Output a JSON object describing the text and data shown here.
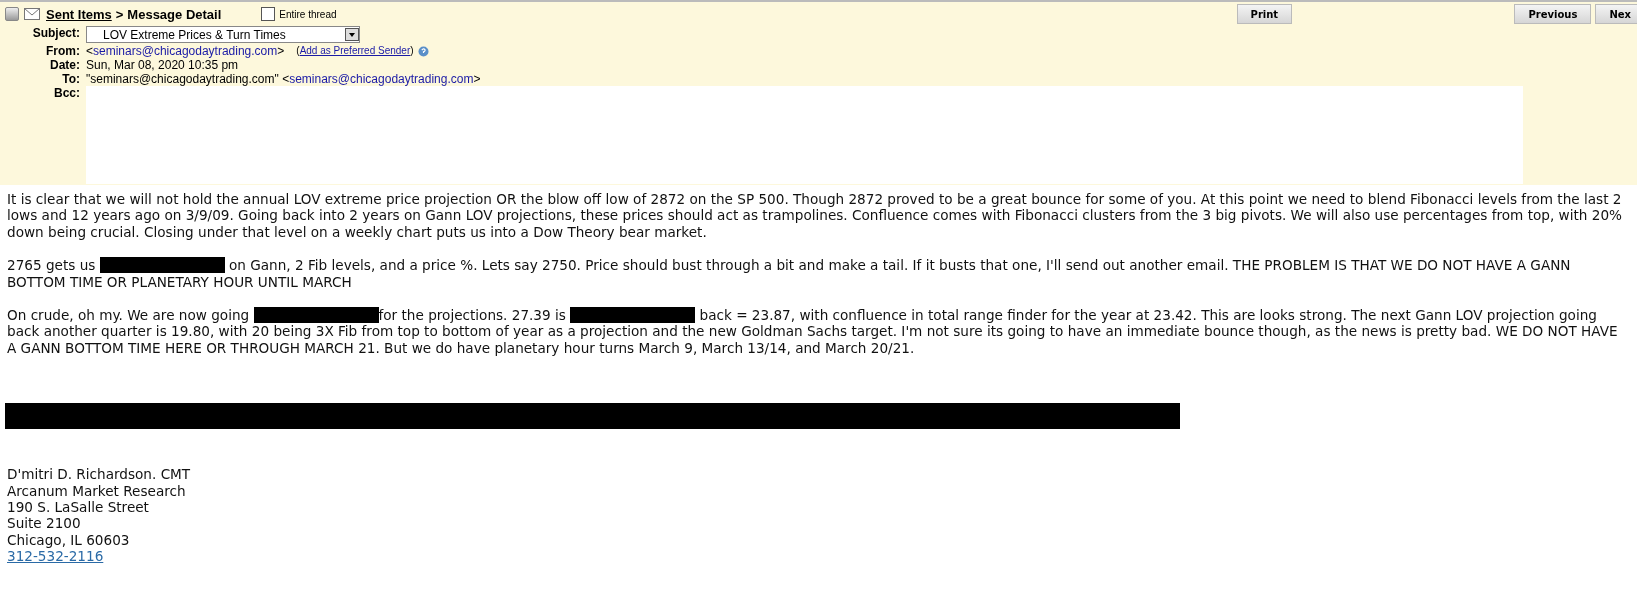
{
  "header": {
    "breadcrumb": {
      "link": "Sent Items",
      "separator": ">",
      "current": "Message Detail"
    },
    "entire_thread": {
      "label": "Entire thread",
      "checked": false
    },
    "buttons": [
      "Print",
      "Previous",
      "Nex"
    ],
    "subject": {
      "label": "Subject:",
      "value": "LOV Extreme Prices & Turn Times"
    },
    "from": {
      "label": "From:",
      "open": "<",
      "address": "seminars@chicagodaytrading.com",
      "close": ">",
      "paren_open": "(",
      "preferred_link": "Add as Preferred Sender",
      "paren_close": ")"
    },
    "date": {
      "label": "Date:",
      "value": "Sun, Mar 08, 2020 10:35 pm"
    },
    "to": {
      "label": "To:",
      "name": "\"seminars@chicagodaytrading.com\"",
      "open": "<",
      "address": "seminars@chicagodaytrading.com",
      "close": ">"
    },
    "bcc": {
      "label": "Bcc:"
    }
  },
  "body": {
    "paragraphs": [
      [
        {
          "kind": "text",
          "text": "It is clear that we will not hold the annual LOV extreme price projection OR the blow off low of 2872 on the SP 500. Though 2872 proved to be a great bounce for some of you. At this point we need to blend Fibonacci levels from the last 2 lows and 12 years ago on 3/9/09. Going back into 2 years on Gann LOV projections, these prices should act as trampolines. Confluence comes with Fibonacci clusters from the 3 big pivots. We will also use percentages from top, with 20% down being crucial. Closing under that level on a weekly chart puts us into a Dow Theory bear market."
        }
      ],
      [
        {
          "kind": "text",
          "text": "2765 gets us "
        },
        {
          "kind": "redacted"
        },
        {
          "kind": "text",
          "text": " on Gann, 2 Fib levels, and a price %. Lets say 2750. Price should bust through a bit and make a tail. If it busts that one, I'll send out another email. THE PROBLEM IS THAT WE DO NOT HAVE A GANN BOTTOM TIME OR PLANETARY HOUR UNTIL MARCH"
        }
      ],
      [
        {
          "kind": "text",
          "text": "On crude, oh my. We are now going "
        },
        {
          "kind": "redacted"
        },
        {
          "kind": "text",
          "text": "for the projections. 27.39 is "
        },
        {
          "kind": "redacted"
        },
        {
          "kind": "text",
          "text": " back = 23.87, with confluence in total range finder for the year at 23.42. This are looks strong. The next Gann LOV projection going back another quarter is 19.80, with 20 being 3X Fib from top to bottom of year as a projection and the new Goldman Sachs target. I'm not sure its going to have an immediate bounce though, as the news is pretty bad. WE DO NOT HAVE A GANN BOTTOM TIME HERE OR THROUGH MARCH 21. But we do have planetary hour turns March 9, March 13/14, and March 20/21."
        }
      ]
    ],
    "signature": [
      {
        "kind": "text",
        "text": "D'mitri D. Richardson. CMT"
      },
      {
        "kind": "text",
        "text": "Arcanum Market Research"
      },
      {
        "kind": "text",
        "text": "190 S. LaSalle Street"
      },
      {
        "kind": "text",
        "text": "Suite 2100"
      },
      {
        "kind": "text",
        "text": "Chicago, IL 60603"
      },
      {
        "kind": "link",
        "text": "312-532-2116"
      }
    ]
  }
}
